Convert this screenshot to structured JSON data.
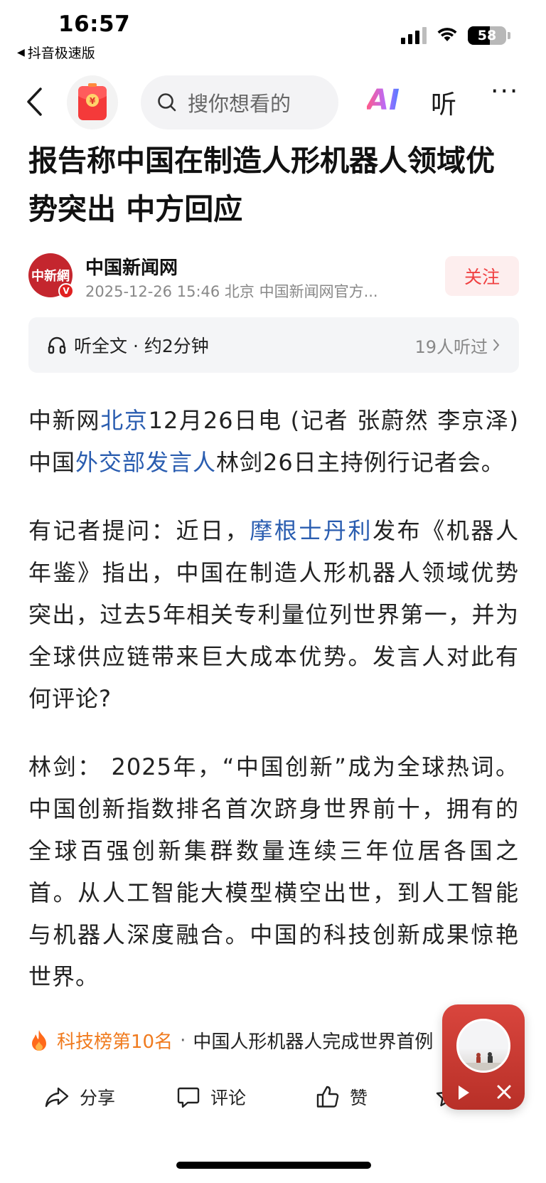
{
  "status_bar": {
    "time": "16:57",
    "back_app": "抖音极速版",
    "battery": "58",
    "battery_level": 0.58
  },
  "nav": {
    "search_placeholder": "搜你想看的",
    "ai_label": "AI",
    "listen_label": "听",
    "more_label": "···"
  },
  "article": {
    "headline": "报告称中国在制造人形机器人领域优势突出 中方回应",
    "author": {
      "logo_text": "中新網",
      "name": "中国新闻网",
      "meta": "2025-12-26  15:46  北京  中国新闻网官方..."
    },
    "follow_label": "关注",
    "listen": {
      "label": "听全文 · 约2分钟",
      "count": "19人听过"
    },
    "paragraphs": {
      "p1": {
        "a": "中新网",
        "link1": "北京",
        "b": "12月26日电 (记者 张蔚然 李京泽)中国",
        "link2": "外交部发言人",
        "c": "林剑26日主持例行记者会。"
      },
      "p2": {
        "a": "有记者提问：近日，",
        "link1": "摩根士丹利",
        "b": "发布《机器人年鉴》指出，中国在制造人形机器人领域优势突出，过去5年相关专利量位列世界第一，并为全球供应链带来巨大成本优势。发言人对此有何评论?"
      },
      "p3": "林剑： 2025年，“中国创新”成为全球热词。中国创新指数排名首次跻身世界前十，拥有的全球百强创新集群数量连续三年位居各国之首。从人工智能大模型横空出世，到人工智能与机器人深度融合。中国的科技创新成果惊艳世界。"
    }
  },
  "hot_bar": {
    "rank": "科技榜第10名",
    "separator": "·",
    "title": "中国人形机器人完成世界首例"
  },
  "actions": {
    "share": "分享",
    "comment": "评论",
    "like": "赞"
  }
}
